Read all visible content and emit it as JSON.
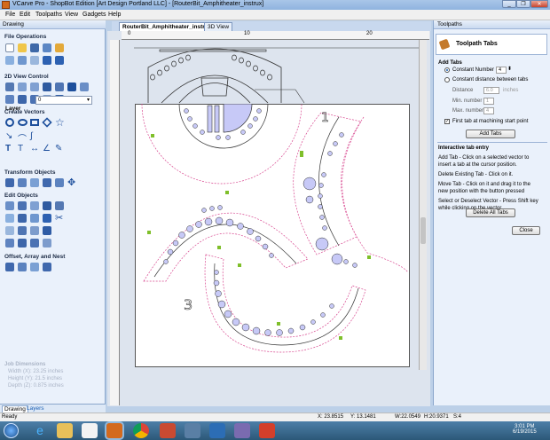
{
  "window": {
    "title": "VCarve Pro - ShopBot Edition [Art Design Portland LLC] - [RouterBit_Amphitheater_instrux]",
    "controls": [
      "_",
      "❐",
      "✕"
    ]
  },
  "menu": [
    "File",
    "Edit",
    "Toolpaths",
    "View",
    "Gadgets",
    "Help"
  ],
  "left_panel": {
    "title": "Drawing",
    "sections": {
      "file_ops": "File Operations",
      "view_control": "2D View Control",
      "layer_label": "Layer",
      "layer_value": "0",
      "create_vectors": "Create Vectors",
      "transform": "Transform Objects",
      "edit": "Edit Objects",
      "offset": "Offset, Array and Nest"
    },
    "job_dims": {
      "title": "Job Dimensions",
      "width": "Width  (X): 23.25 inches",
      "height": "Height (Y): 21.5 inches",
      "depth": "Depth  (Z): 0.875 inches"
    },
    "tabs": [
      "Drawing",
      "Layers"
    ]
  },
  "drawing_tabs": [
    "RouterBit_Amphitheater_instrux",
    "3D View"
  ],
  "ruler_labels": [
    "0",
    "10",
    "20"
  ],
  "right_panel": {
    "header": "Toolpaths",
    "tool_title": "Toolpath Tabs",
    "add_tabs": "Add Tabs",
    "constant_number": "Constant Number",
    "constant_number_value": "4",
    "constant_distance": "Constant distance between tabs",
    "distance_label": "Distance",
    "distance_value": "6.0",
    "distance_unit": "inches",
    "min_label": "Min. number",
    "min_value": "1",
    "max_label": "Max. number",
    "max_value": "4",
    "first_tab": "First tab at machining start point",
    "add_tabs_button": "Add Tabs",
    "interactive_title": "Interactive tab entry",
    "instructions": [
      "Add Tab - Click on a selected vector to",
      "insert a tab at the cursor position.",
      "Delete Existing Tab - Click on it.",
      "Move Tab - Click on it and drag it to the",
      "new position with the button pressed",
      "Select or Deselect Vector - Press Shift key",
      "while clicking on the vector"
    ],
    "delete_all_button": "Delete All Tabs",
    "close_button": "Close"
  },
  "status": {
    "ready": "Ready",
    "x": "X: 23.8515",
    "y": "Y: 13.1481",
    "w": "W:22.0549",
    "h": "H:20.9371",
    "s": "S:4"
  },
  "taskbar": {
    "time": "3:01 PM",
    "date": "6/19/2015"
  },
  "colors": {
    "accent": "#1a5fb4",
    "hole_fill": "#c7c9f7",
    "tab_marker": "#7fbf2a",
    "toolpath_line": "#d8478f"
  }
}
